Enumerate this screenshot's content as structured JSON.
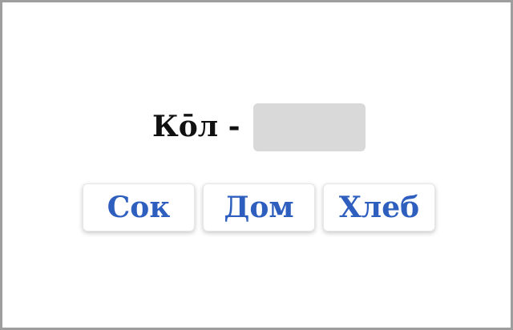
{
  "question": {
    "prompt": "Ко̄л -",
    "answer_value": ""
  },
  "options": [
    {
      "label": "Сок"
    },
    {
      "label": "Дом"
    },
    {
      "label": "Хлеб"
    }
  ],
  "colors": {
    "border": "#9e9e9e",
    "slot": "#d9d9d9",
    "option_text": "#2e5fbf",
    "prompt_text": "#111111"
  }
}
